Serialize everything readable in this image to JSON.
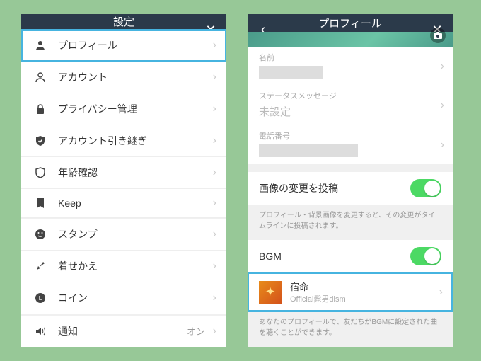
{
  "left": {
    "title": "設定",
    "items": [
      {
        "label": "プロフィール",
        "highlight": true,
        "icon": "person"
      },
      {
        "label": "アカウント",
        "icon": "user"
      },
      {
        "label": "プライバシー管理",
        "icon": "lock"
      },
      {
        "label": "アカウント引き継ぎ",
        "icon": "shield-check"
      },
      {
        "label": "年齢確認",
        "icon": "shield"
      },
      {
        "label": "Keep",
        "icon": "bookmark"
      }
    ],
    "items2": [
      {
        "label": "スタンプ",
        "icon": "smiley"
      },
      {
        "label": "着せかえ",
        "icon": "brush"
      },
      {
        "label": "コイン",
        "icon": "coin"
      }
    ],
    "items3": [
      {
        "label": "通知",
        "icon": "speaker",
        "trailing": "オン"
      }
    ]
  },
  "right": {
    "title": "プロフィール",
    "fields": {
      "name_label": "名前",
      "status_label": "ステータスメッセージ",
      "status_value": "未設定",
      "phone_label": "電話番号"
    },
    "post_image_label": "画像の変更を投稿",
    "post_image_hint": "プロフィール・背景画像を変更すると、その変更がタイムラインに投稿されます。",
    "bgm_label": "BGM",
    "song": {
      "title": "宿命",
      "artist": "Official髭男dism"
    },
    "bgm_hint": "あなたのプロフィールで、友だちがBGMに設定された曲を聴くことができます。"
  }
}
